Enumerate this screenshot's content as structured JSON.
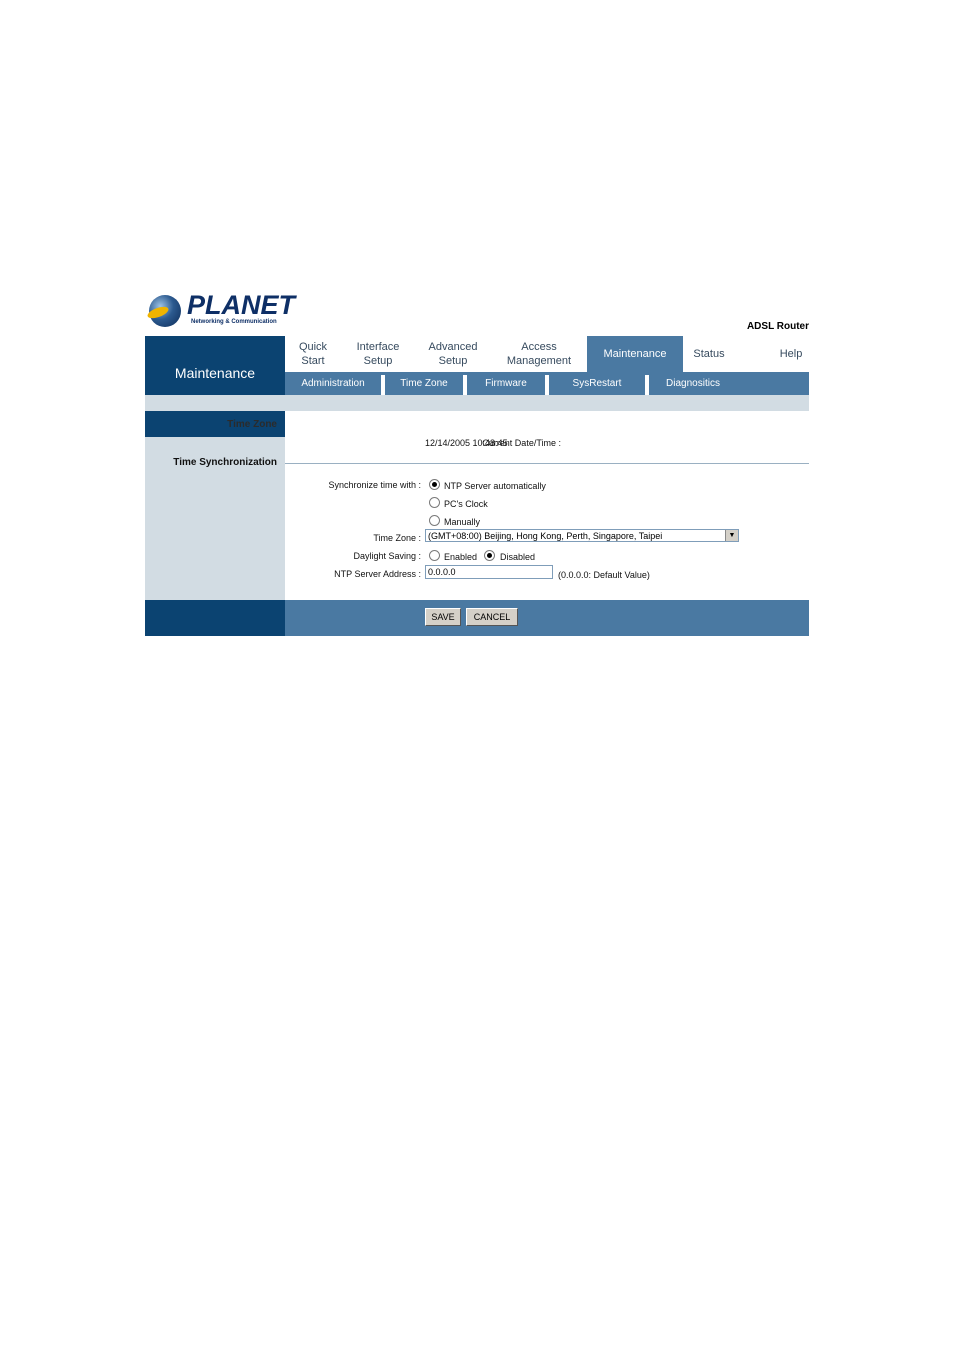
{
  "header": {
    "logo_text": "PLANET",
    "logo_tagline": "Networking & Communication",
    "product": "ADSL Router"
  },
  "nav": {
    "section_title": "Maintenance",
    "tabs": [
      {
        "line1": "Quick",
        "line2": "Start"
      },
      {
        "line1": "Interface",
        "line2": "Setup"
      },
      {
        "line1": "Advanced",
        "line2": "Setup"
      },
      {
        "line1": "Access",
        "line2": "Management"
      },
      {
        "line1": "Maintenance",
        "line2": ""
      },
      {
        "line1": "Status",
        "line2": ""
      },
      {
        "line1": "Help",
        "line2": ""
      }
    ],
    "active_tab": "Maintenance"
  },
  "subnav": {
    "items": [
      "Administration",
      "Time Zone",
      "Firmware",
      "SysRestart",
      "Diagnositics"
    ]
  },
  "sidebar": {
    "time_zone": "Time Zone",
    "time_sync": "Time Synchronization"
  },
  "form": {
    "current_datetime_label": "Current Date/Time :",
    "current_datetime_value": "12/14/2005 10:48:45",
    "sync_label": "Synchronize time with :",
    "sync_options": [
      "NTP Server automatically",
      "PC's Clock",
      "Manually"
    ],
    "sync_selected": "NTP Server automatically",
    "time_zone_label": "Time Zone :",
    "time_zone_value": "(GMT+08:00) Beijing, Hong Kong, Perth, Singapore, Taipei",
    "daylight_label": "Daylight Saving :",
    "daylight_options": [
      "Enabled",
      "Disabled"
    ],
    "daylight_selected": "Disabled",
    "ntp_label": "NTP Server Address :",
    "ntp_value": "0.0.0.0",
    "ntp_hint": "(0.0.0.0: Default Value)"
  },
  "buttons": {
    "save": "SAVE",
    "cancel": "CANCEL"
  }
}
